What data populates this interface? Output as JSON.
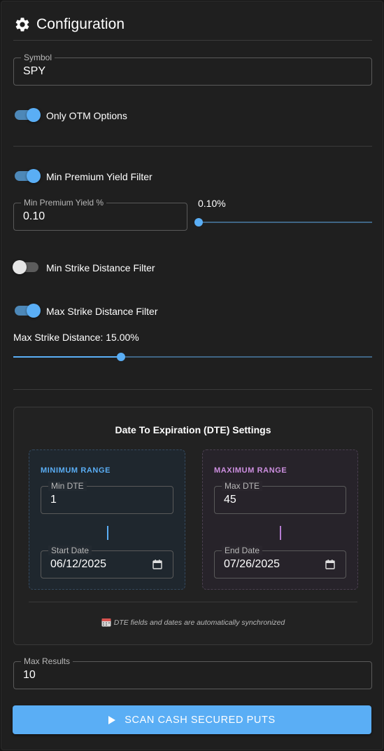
{
  "header": {
    "title": "Configuration",
    "icon": "gear-icon"
  },
  "symbol": {
    "label": "Symbol",
    "value": "SPY"
  },
  "toggles": {
    "otm": {
      "label": "Only OTM Options",
      "on": true
    },
    "min_premium": {
      "label": "Min Premium Yield Filter",
      "on": true
    },
    "min_strike": {
      "label": "Min Strike Distance Filter",
      "on": false
    },
    "max_strike": {
      "label": "Max Strike Distance Filter",
      "on": true
    }
  },
  "min_premium_yield": {
    "label": "Min Premium Yield %",
    "value": "0.10",
    "slider_text": "0.10%",
    "slider_level": 0.0
  },
  "max_strike_distance": {
    "label": "Max Strike Distance: 15.00%",
    "slider_level": 0.3
  },
  "dte": {
    "title": "Date To Expiration (DTE) Settings",
    "min": {
      "heading": "MINIMUM RANGE",
      "dte_label": "Min DTE",
      "dte_value": "1",
      "date_label": "Start Date",
      "date_value": "06/12/2025"
    },
    "max": {
      "heading": "MAXIMUM RANGE",
      "dte_label": "Max DTE",
      "dte_value": "45",
      "date_label": "End Date",
      "date_value": "07/26/2025"
    },
    "note": "DTE fields and dates are automatically synchronized"
  },
  "max_results": {
    "label": "Max Results",
    "value": "10"
  },
  "scan_button": {
    "label": "SCAN CASH SECURED PUTS"
  },
  "colors": {
    "accent": "#5aaef5",
    "max_accent": "#cd8fe0",
    "background": "#1f1f1f"
  }
}
